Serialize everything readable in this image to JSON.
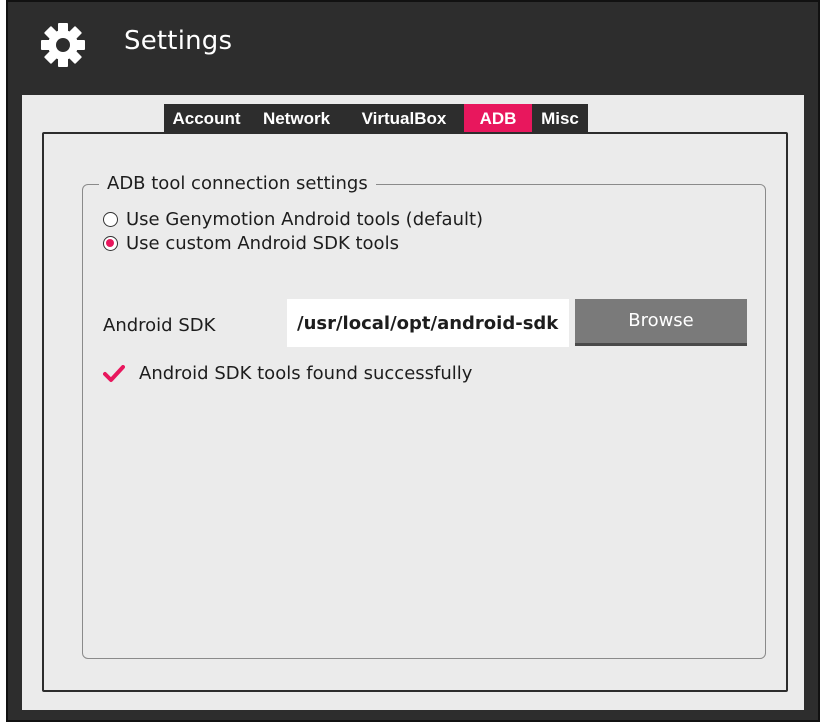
{
  "window": {
    "title": "Settings"
  },
  "icons": {
    "settings": "gear-icon",
    "status": "checkmark-icon"
  },
  "colors": {
    "accent": "#e8175d",
    "header_bg": "#2d2d2d",
    "panel_bg": "#ebebeb",
    "button_bg": "#7a7a7a"
  },
  "tabs": [
    {
      "label": "Account",
      "active": false
    },
    {
      "label": "Network",
      "active": false
    },
    {
      "label": "VirtualBox",
      "active": false
    },
    {
      "label": "ADB",
      "active": true
    },
    {
      "label": "Misc",
      "active": false
    }
  ],
  "adb": {
    "group_title": "ADB tool connection settings",
    "radio_genymotion": "Use Genymotion Android tools (default)",
    "radio_custom": "Use custom Android SDK tools",
    "selected_option": "Use custom Android SDK tools",
    "sdk_label": "Android SDK",
    "sdk_path": "/usr/local/opt/android-sdk",
    "browse_label": "Browse",
    "status_text": "Android SDK tools found successfully"
  }
}
